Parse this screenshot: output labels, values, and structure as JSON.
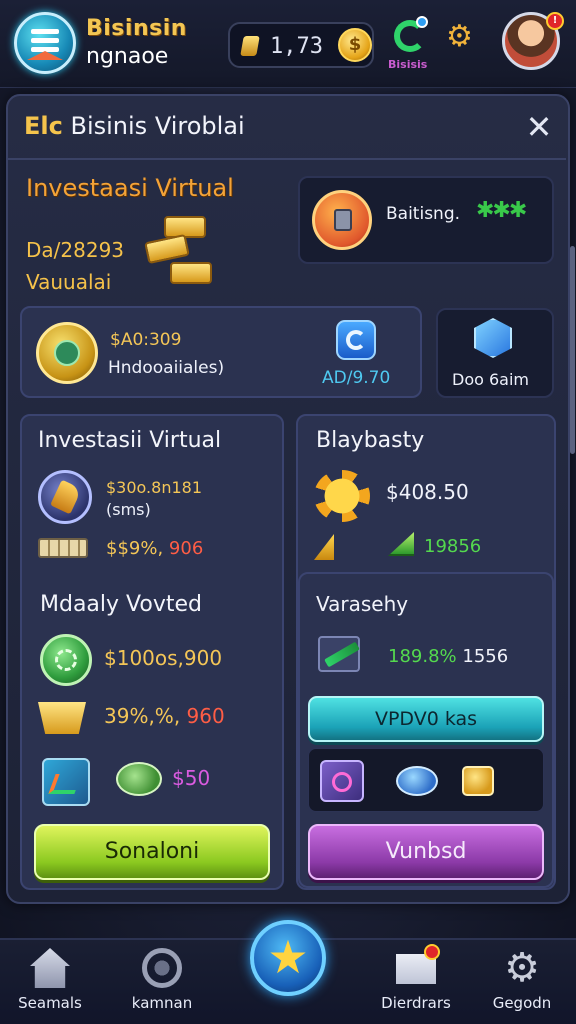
{
  "header": {
    "brand_line1": "Bisinsin",
    "brand_line2": "ngnaoe",
    "coins": "1,73",
    "refresh_label": "Bisisis"
  },
  "modal": {
    "title_tag": "Elc",
    "title": "Bisinis Viroblai",
    "close_glyph": "✕"
  },
  "hero": {
    "title": "Investaasi Virtual",
    "line1": "Da/28293",
    "line2": "Vauualai"
  },
  "badge": {
    "text": "Baitisng.",
    "stars": "✱✱✱"
  },
  "account": {
    "value": "$A0:309",
    "sub": "Hndooaiiales)",
    "rate": "AD/9.70"
  },
  "cube_card": {
    "label": "Doo 6aim"
  },
  "left_panel": {
    "title": "Investasii Virtual",
    "value": "$30o.8n181",
    "sub": "(sms)",
    "gain_prefix": "$$9%,",
    "gain_suffix": "906",
    "section2_title": "Mdaaly Vovted",
    "value2": "$100os,900",
    "value3_prefix": "39%,%,",
    "value3_suffix": "960",
    "value4": "$50",
    "button": "Sonaloni"
  },
  "right_panel": {
    "title": "Blaybasty",
    "value": "$408.50",
    "gain": "19856",
    "sub_title": "Varasehy",
    "sub_value_prefix": "189.8%",
    "sub_value_suffix": "1556",
    "button_teal": "VPDV0 kas",
    "button_purple": "Vunbsd"
  },
  "bottom_nav": [
    {
      "label": "Seamals",
      "icon": "home-icon"
    },
    {
      "label": "kamnan",
      "icon": "gauge-icon"
    },
    {
      "label": "",
      "icon": "star-icon"
    },
    {
      "label": "Dierdrars",
      "icon": "mail-icon"
    },
    {
      "label": "Gegodn",
      "icon": "gear-icon"
    }
  ],
  "colors": {
    "accent_gold": "#f4c657",
    "gain_green": "#54d94e",
    "loss_red": "#ff5d45",
    "button_green": "#8bc920",
    "button_teal": "#1ba2b7",
    "button_purple": "#8c3aa8"
  }
}
